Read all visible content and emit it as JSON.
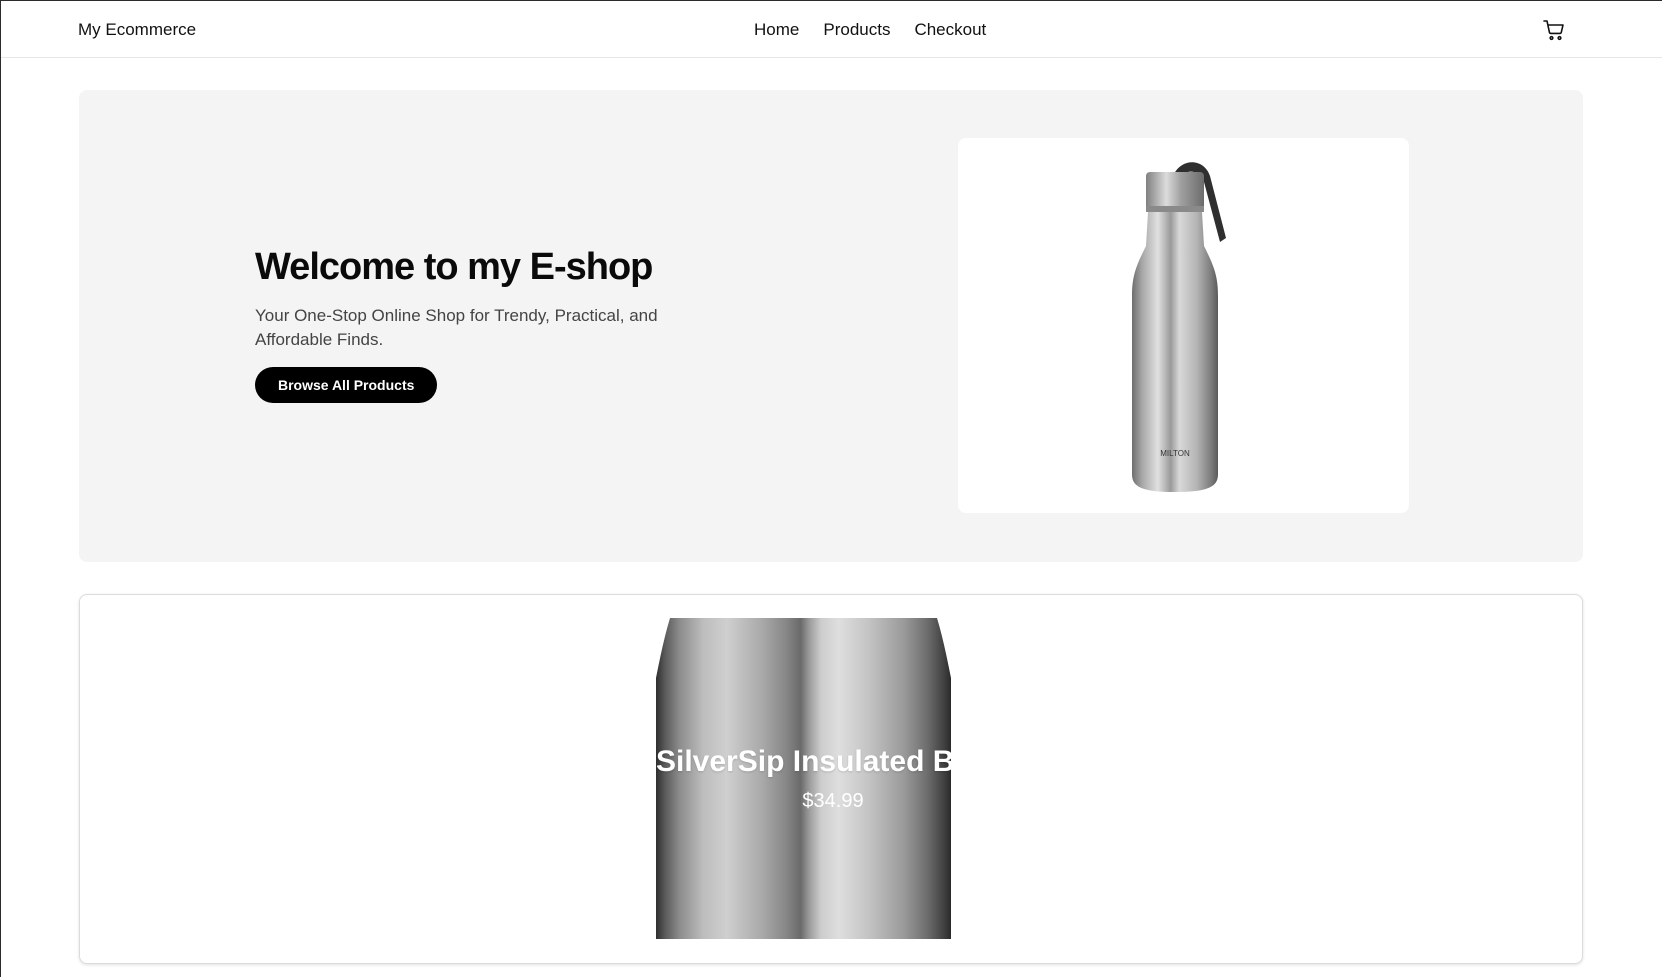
{
  "navbar": {
    "brand": "My Ecommerce",
    "links": [
      {
        "label": "Home"
      },
      {
        "label": "Products"
      },
      {
        "label": "Checkout"
      }
    ],
    "cart_icon": "shopping-cart-icon"
  },
  "hero": {
    "title": "Welcome to my E-shop",
    "subtitle": "Your One-Stop Online Shop for Trendy, Practical, and Affordable Finds.",
    "button_label": "Browse All Products",
    "image_label": "MILTON"
  },
  "featured_product": {
    "name": "SilverSip Insulated Bottle",
    "price": "$34.99"
  },
  "colors": {
    "hero_bg": "#f4f4f4",
    "button_bg": "#000000",
    "button_text": "#ffffff"
  }
}
